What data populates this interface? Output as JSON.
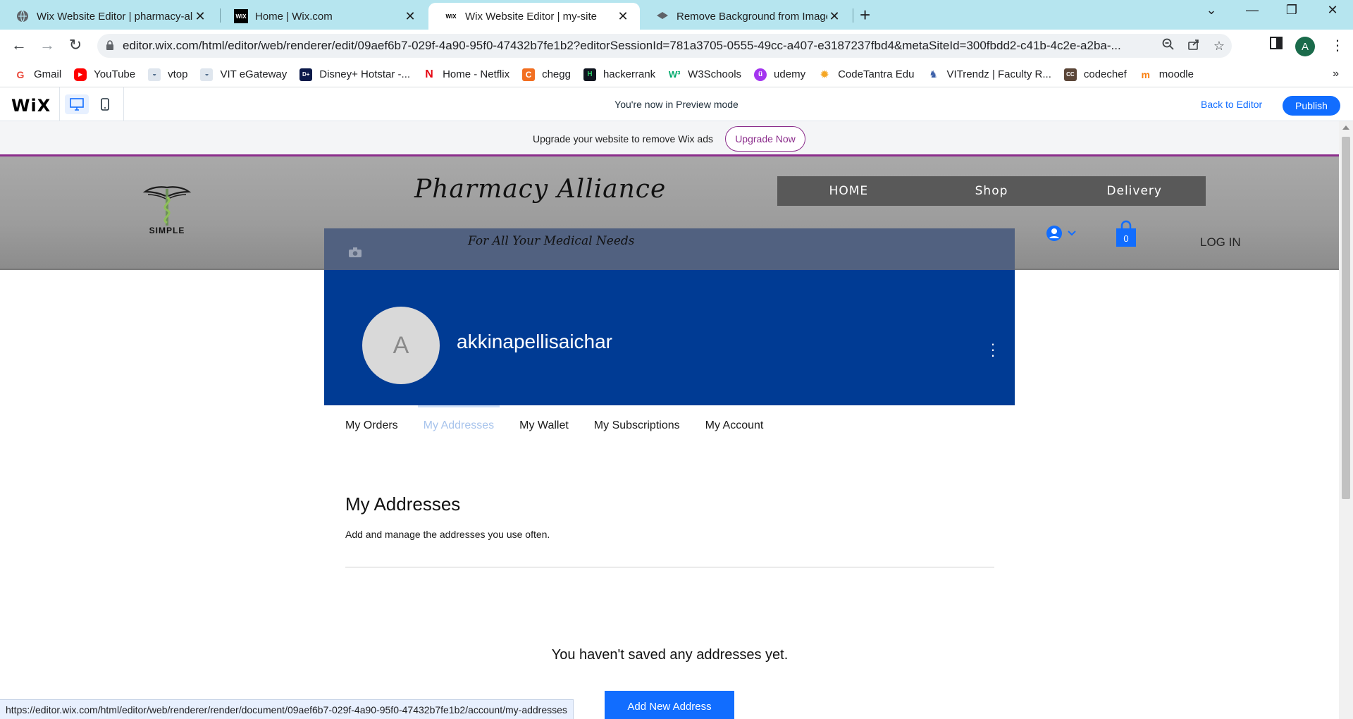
{
  "browser": {
    "tabs": [
      {
        "title": "Wix Website Editor | pharmacy-al",
        "active": false
      },
      {
        "title": "Home | Wix.com",
        "active": false
      },
      {
        "title": "Wix Website Editor | my-site",
        "active": true
      },
      {
        "title": "Remove Background from Image",
        "active": false
      }
    ],
    "url": "editor.wix.com/html/editor/web/renderer/edit/09aef6b7-029f-4a90-95f0-47432b7fe1b2?editorSessionId=781a3705-0555-49cc-a407-e3187237fbd4&metaSiteId=300fbdd2-c41b-4c2e-a2ba-...",
    "profile_initial": "A",
    "bookmarks": [
      {
        "label": "Gmail",
        "icon": "gmail-icon",
        "color": "#ea4335"
      },
      {
        "label": "YouTube",
        "icon": "youtube-icon",
        "color": "#ff0000"
      },
      {
        "label": "vtop",
        "icon": "vtop-icon",
        "color": "#8aa0b8"
      },
      {
        "label": "VIT eGateway",
        "icon": "vit-icon",
        "color": "#8aa0b8"
      },
      {
        "label": "Disney+ Hotstar -...",
        "icon": "hotstar-icon",
        "color": "#0c1a4a"
      },
      {
        "label": "Home - Netflix",
        "icon": "netflix-icon",
        "color": "#e50914"
      },
      {
        "label": "chegg",
        "icon": "chegg-icon",
        "color": "#f26f21"
      },
      {
        "label": "hackerrank",
        "icon": "hackerrank-icon",
        "color": "#0e141e"
      },
      {
        "label": "W3Schools",
        "icon": "w3schools-icon",
        "color": "#04aa6d"
      },
      {
        "label": "udemy",
        "icon": "udemy-icon",
        "color": "#a435f0"
      },
      {
        "label": "CodeTantra Edu",
        "icon": "codetantra-icon",
        "color": "#f5a623"
      },
      {
        "label": "VITrendz | Faculty R...",
        "icon": "vitrendz-icon",
        "color": "#3b5fa8"
      },
      {
        "label": "codechef",
        "icon": "codechef-icon",
        "color": "#5b4638"
      },
      {
        "label": "moodle",
        "icon": "moodle-icon",
        "color": "#f98012"
      }
    ],
    "status_url": "https://editor.wix.com/html/editor/web/renderer/render/document/09aef6b7-029f-4a90-95f0-47432b7fe1b2/account/my-addresses"
  },
  "wix_bar": {
    "logo": "WiX",
    "preview_text": "You're now in Preview mode",
    "back_label": "Back to Editor",
    "publish_label": "Publish"
  },
  "upgrade": {
    "text": "Upgrade your website to remove Wix ads",
    "button": "Upgrade Now"
  },
  "site": {
    "logo_text": "SIMPLE",
    "title": "Pharmacy Alliance",
    "tagline": "For All Your Medical Needs",
    "nav": [
      "HOME",
      "Shop",
      "Delivery"
    ],
    "cart_count": "0",
    "login_label": "LOG IN"
  },
  "profile": {
    "initial": "A",
    "username": "akkinapellisaichar",
    "tabs": [
      {
        "label": "My Orders",
        "selected": false
      },
      {
        "label": "My Addresses",
        "selected": true
      },
      {
        "label": "My Wallet",
        "selected": false
      },
      {
        "label": "My Subscriptions",
        "selected": false
      },
      {
        "label": "My Account",
        "selected": false
      }
    ]
  },
  "addresses": {
    "title": "My Addresses",
    "subtitle": "Add and manage the addresses you use often.",
    "empty_text": "You haven't saved any addresses yet.",
    "add_button": "Add New Address"
  },
  "colors": {
    "accent": "#116dff",
    "cover": "#003b94",
    "upgrade_accent": "#8c2e8c",
    "tabstrip": "#b6e5ef"
  }
}
